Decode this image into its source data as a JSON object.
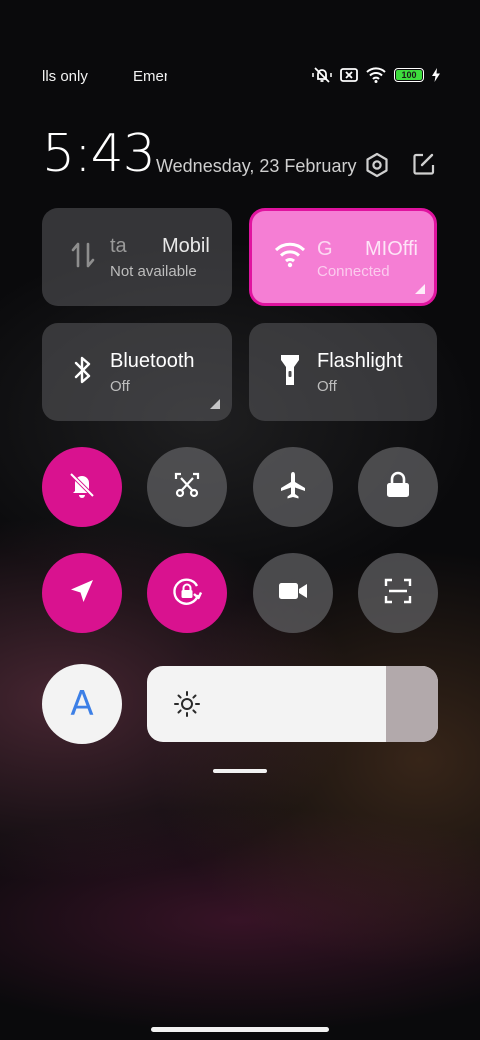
{
  "status_bar": {
    "left_text_1": "lls only",
    "left_text_2": "Emergency",
    "battery_level": "100",
    "icons": [
      "mute-vibrate-icon",
      "no-sim-icon",
      "wifi-icon",
      "battery-icon",
      "charging-bolt-icon"
    ]
  },
  "header": {
    "time": "5:43",
    "date": "Wednesday, 23 February",
    "icons": [
      "settings-icon",
      "edit-icon"
    ]
  },
  "tiles": {
    "mobile_data": {
      "title_a": "ta",
      "title_b": "Mobil",
      "status": "Not available",
      "icon": "mobile-data-arrows-icon"
    },
    "wifi": {
      "title_a": "G",
      "title_b": "MIOffi",
      "status": "Connected",
      "icon": "wifi-icon",
      "active": true
    },
    "bluetooth": {
      "title": "Bluetooth",
      "status": "Off",
      "icon": "bluetooth-icon"
    },
    "flashlight": {
      "title": "Flashlight",
      "status": "Off",
      "icon": "flashlight-icon"
    }
  },
  "toggles": [
    {
      "name": "silent",
      "icon": "bell-off-icon",
      "on": true
    },
    {
      "name": "screenshot",
      "icon": "scissors-screenshot-icon",
      "on": false
    },
    {
      "name": "airplane",
      "icon": "airplane-icon",
      "on": false
    },
    {
      "name": "lock-screen",
      "icon": "lock-icon",
      "on": false
    },
    {
      "name": "location",
      "icon": "location-arrow-icon",
      "on": true
    },
    {
      "name": "rotation-lock",
      "icon": "rotation-lock-icon",
      "on": true
    },
    {
      "name": "screen-recorder",
      "icon": "video-camera-icon",
      "on": false
    },
    {
      "name": "scanner",
      "icon": "scan-icon",
      "on": false
    }
  ],
  "brightness": {
    "auto_label": "A",
    "level_fraction": 0.82,
    "icon": "sun-icon"
  },
  "colors": {
    "accent": "#d9128f",
    "wifi_tile": "#f57ed4",
    "auto_letter": "#3c7fe6",
    "battery_fill": "#3ddc3d"
  }
}
